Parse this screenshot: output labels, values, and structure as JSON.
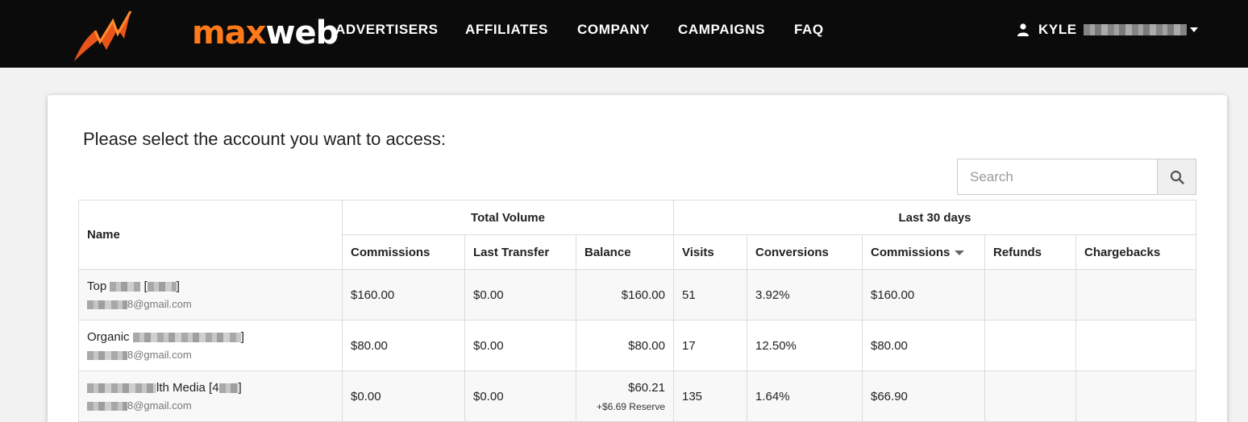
{
  "brand": {
    "logo_max": "max",
    "logo_web": "web",
    "accent": "#ff7a1a"
  },
  "nav": [
    {
      "label": "ADVERTISERS"
    },
    {
      "label": "AFFILIATES"
    },
    {
      "label": "COMPANY"
    },
    {
      "label": "CAMPAIGNS"
    },
    {
      "label": "FAQ"
    }
  ],
  "user": {
    "name": "KYLE",
    "icon": "user-icon"
  },
  "page": {
    "heading": "Please select the account you want to access:"
  },
  "search": {
    "placeholder": "Search",
    "icon": "search-icon"
  },
  "table": {
    "name_header": "Name",
    "group_total": "Total Volume",
    "group_last30": "Last 30 days",
    "columns": {
      "commissions": "Commissions",
      "last_transfer": "Last Transfer",
      "balance": "Balance",
      "visits": "Visits",
      "conversions": "Conversions",
      "commissions_30": "Commissions",
      "refunds": "Refunds",
      "chargebacks": "Chargebacks"
    },
    "rows": [
      {
        "name_prefix": "Top",
        "name_suffix": "[",
        "name_end": "]",
        "email_suffix": "8@gmail.com",
        "commissions": "$160.00",
        "last_transfer": "$0.00",
        "balance": "$160.00",
        "reserve": "",
        "visits": "51",
        "conversions": "3.92%",
        "commissions_30": "$160.00",
        "refunds": "",
        "chargebacks": ""
      },
      {
        "name_prefix": "Organic",
        "name_suffix": "",
        "name_end": "]",
        "email_suffix": "8@gmail.com",
        "commissions": "$80.00",
        "last_transfer": "$0.00",
        "balance": "$80.00",
        "reserve": "",
        "visits": "17",
        "conversions": "12.50%",
        "commissions_30": "$80.00",
        "refunds": "",
        "chargebacks": ""
      },
      {
        "name_prefix": "",
        "name_suffix": "lth Media [4",
        "name_end": "]",
        "email_suffix": "8@gmail.com",
        "commissions": "$0.00",
        "last_transfer": "$0.00",
        "balance": "$60.21",
        "reserve": "+$6.69 Reserve",
        "visits": "135",
        "conversions": "1.64%",
        "commissions_30": "$66.90",
        "refunds": "",
        "chargebacks": ""
      }
    ]
  }
}
